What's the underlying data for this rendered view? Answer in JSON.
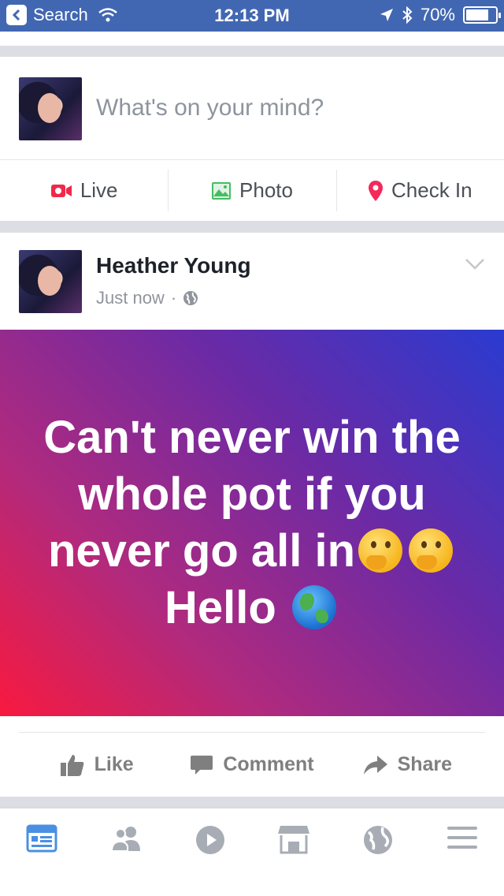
{
  "status_bar": {
    "back_label": "Search",
    "time": "12:13 PM",
    "battery": "70%"
  },
  "composer": {
    "placeholder": "What's on your mind?",
    "actions": [
      {
        "label": "Live",
        "icon": "live-video-icon",
        "color": "#f02849"
      },
      {
        "label": "Photo",
        "icon": "photo-icon",
        "color": "#45bd62"
      },
      {
        "label": "Check In",
        "icon": "location-pin-icon",
        "color": "#f5533d"
      }
    ]
  },
  "post": {
    "author": "Heather Young",
    "timestamp": "Just now",
    "privacy_icon": "globe-icon",
    "text_part1": "Can't never win the  whole pot if you never go all in",
    "text_part2": "Hello",
    "background_colors": [
      "#2a3bd0",
      "#6a2aa6",
      "#b02a7e",
      "#f8193f"
    ],
    "actions": [
      {
        "label": "Like",
        "icon": "thumbs-up-icon"
      },
      {
        "label": "Comment",
        "icon": "comment-icon"
      },
      {
        "label": "Share",
        "icon": "share-arrow-icon"
      }
    ]
  },
  "tab_bar": {
    "tabs": [
      {
        "name": "news-feed",
        "icon": "news-feed-icon",
        "active": true
      },
      {
        "name": "friends",
        "icon": "friends-icon",
        "active": false
      },
      {
        "name": "watch",
        "icon": "play-icon",
        "active": false
      },
      {
        "name": "marketplace",
        "icon": "marketplace-icon",
        "active": false
      },
      {
        "name": "notifications",
        "icon": "globe-icon",
        "active": false
      },
      {
        "name": "menu",
        "icon": "menu-icon",
        "active": false
      }
    ],
    "active_color": "#4a90e2",
    "inactive_color": "#a8adb5"
  }
}
